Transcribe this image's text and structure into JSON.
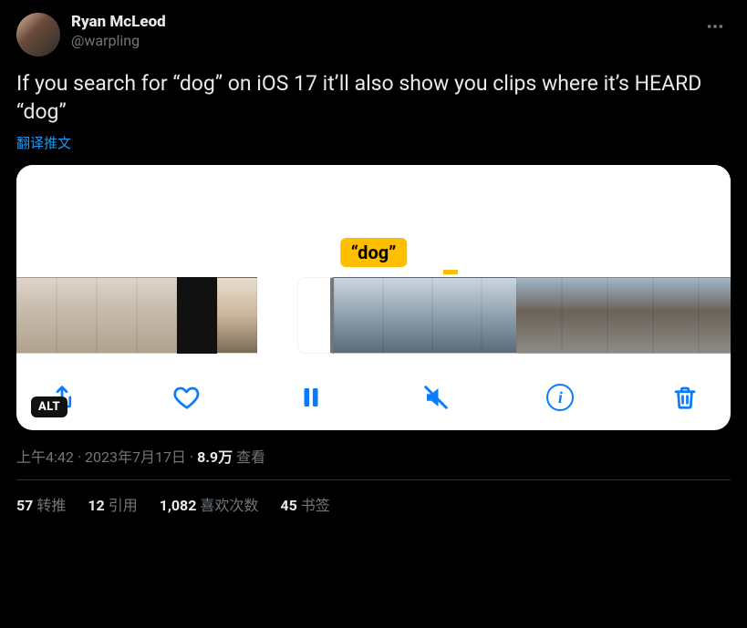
{
  "colors": {
    "link": "#1d9bf0",
    "accent": "#fdbf00",
    "ios_blue": "#0a7bff"
  },
  "header": {
    "display_name": "Ryan McLeod",
    "handle": "@warpling"
  },
  "body": {
    "text": "If you search for “dog” on iOS 17 it’ll also show you clips where it’s HEARD “dog”",
    "translate_label": "翻译推文"
  },
  "media": {
    "search_term": "“dog”",
    "alt_badge": "ALT",
    "icons": {
      "share": "share-icon",
      "heart": "heart-icon",
      "pause": "pause-icon",
      "mute": "speaker-mute-icon",
      "info": "info-icon",
      "trash": "trash-icon"
    }
  },
  "meta": {
    "time": "上午4:42",
    "dot1": " · ",
    "date": "2023年7月17日",
    "dot2": " · ",
    "views_count": "8.9万",
    "views_label": " 查看"
  },
  "stats": {
    "retweets": {
      "count": "57",
      "label": "转推"
    },
    "quotes": {
      "count": "12",
      "label": "引用"
    },
    "likes": {
      "count": "1,082",
      "label": "喜欢次数"
    },
    "bookmarks": {
      "count": "45",
      "label": "书签"
    }
  }
}
